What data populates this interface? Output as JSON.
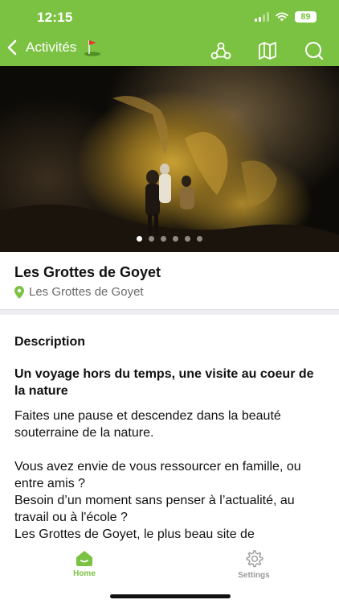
{
  "status_bar": {
    "time": "12:15",
    "battery": "89"
  },
  "nav": {
    "back_label": "Activités"
  },
  "gallery": {
    "page_count": 6,
    "active_index": 0
  },
  "place": {
    "title": "Les Grottes de Goyet",
    "location": "Les Grottes de Goyet"
  },
  "description": {
    "heading": "Description",
    "lead": "Un voyage hors du temps, une visite au coeur de la nature",
    "paragraph1": "Faites une pause et descendez dans la beauté souterraine de la nature.",
    "line1": "Vous avez envie de vous ressourcer en famille, ou entre amis ?",
    "line2": "Besoin d’un moment sans penser à l’actualité, au travail ou à l'école ?",
    "line3": "Les Grottes de Goyet, le plus beau site de"
  },
  "tabs": {
    "home": "Home",
    "settings": "Settings"
  },
  "colors": {
    "accent": "#7cc242",
    "inactive": "#9a9a9a"
  },
  "icons": [
    "back-chevron-icon",
    "golf-flag-icon",
    "share-network-icon",
    "map-book-icon",
    "search-icon",
    "location-pin-icon",
    "home-icon",
    "gear-icon"
  ]
}
